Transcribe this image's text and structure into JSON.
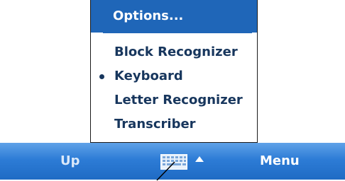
{
  "input_menu": {
    "options_label": "Options...",
    "items": [
      {
        "label": "Block Recognizer",
        "selected": false
      },
      {
        "label": "Keyboard",
        "selected": true
      },
      {
        "label": "Letter Recognizer",
        "selected": false
      },
      {
        "label": "Transcriber",
        "selected": false
      }
    ]
  },
  "taskbar": {
    "left_softkey": "Up",
    "right_softkey": "Menu",
    "sip_icon": "keyboard-icon",
    "sip_arrow_icon": "arrow-up-icon"
  },
  "colors": {
    "menu_header": "#1f66b8",
    "menu_text": "#17365d",
    "taskbar_top": "#5fa2e8",
    "taskbar_bottom": "#1f6bc4"
  }
}
